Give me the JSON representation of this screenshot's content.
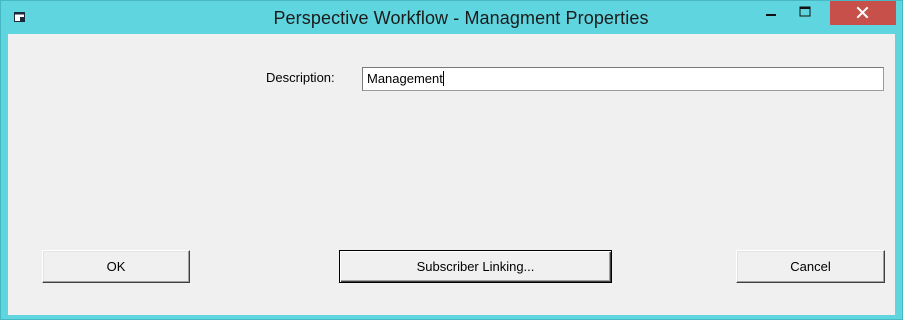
{
  "window": {
    "title": "Perspective Workflow - Managment Properties",
    "colors": {
      "frame": "#5fd5e0",
      "close_button": "#c7504a",
      "client_background": "#f0f0f0"
    },
    "controls": {
      "minimize_icon": "minimize-icon",
      "maximize_icon": "maximize-icon",
      "close_icon": "close-icon"
    }
  },
  "form": {
    "description_label": "Description:",
    "description_value": "Management"
  },
  "buttons": {
    "ok": "OK",
    "subscriber_linking": "Subscriber Linking...",
    "cancel": "Cancel"
  }
}
